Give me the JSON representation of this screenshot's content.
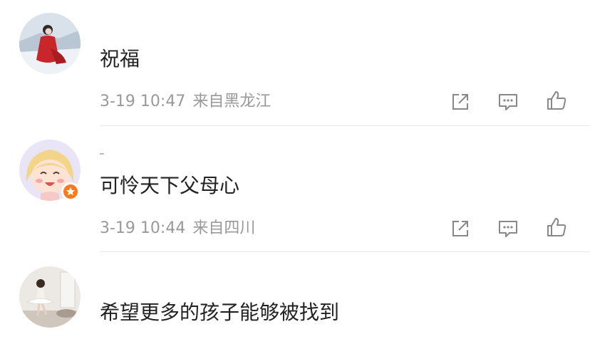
{
  "comments": [
    {
      "text": "祝福",
      "time": "3-19 10:47",
      "location": "来自黑龙江",
      "avatar_icon": "avatar-woman-red-coat",
      "verified": false
    },
    {
      "text": "可怜天下父母心",
      "time": "3-19 10:44",
      "location": "来自四川",
      "avatar_icon": "avatar-cartoon-girl",
      "verified": true
    },
    {
      "text": "希望更多的孩子能够被找到",
      "avatar_icon": "avatar-ballet-dancer",
      "verified": false
    }
  ],
  "actions": {
    "share_icon": "share-icon",
    "reply_icon": "reply-icon",
    "like_icon": "like-icon"
  },
  "colors": {
    "text": "#222222",
    "meta": "#999999",
    "icon": "#888888",
    "badge": "#ff7a1a",
    "divider": "#e8e8e8"
  }
}
